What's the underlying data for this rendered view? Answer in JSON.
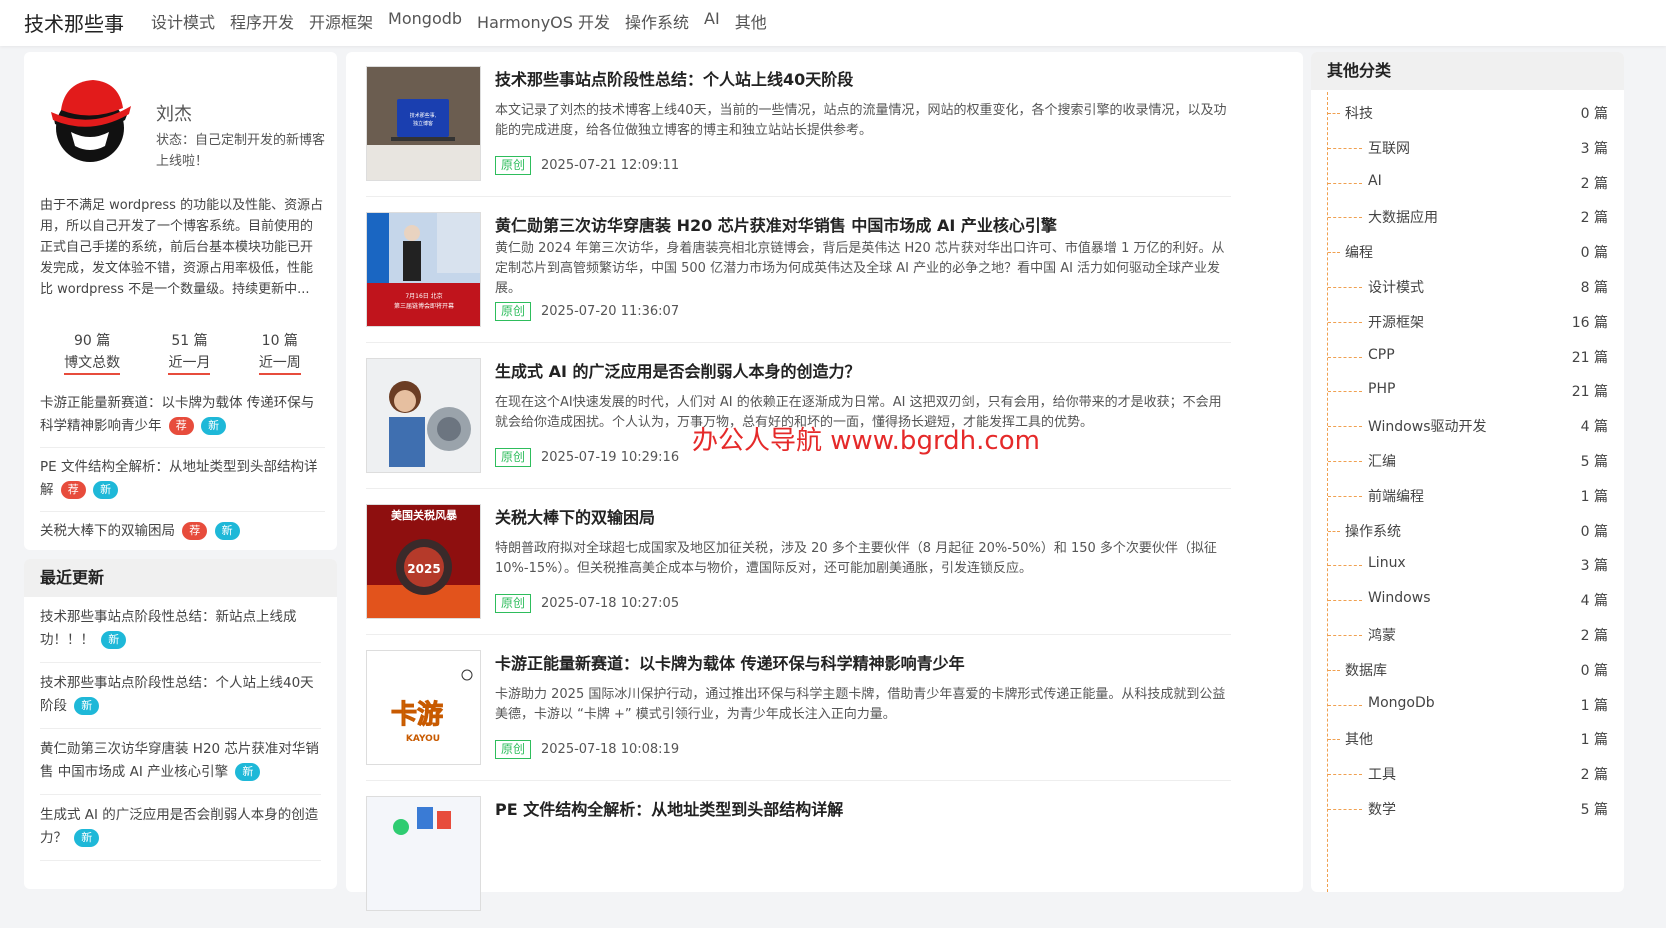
{
  "header": {
    "logo": "技术那些事",
    "nav": [
      "设计模式",
      "程序开发",
      "开源框架",
      "Mongodb",
      "HarmonyOS 开发",
      "操作系统",
      "AI",
      "其他"
    ]
  },
  "profile": {
    "name": "刘杰",
    "status": "状态：自己定制开发的新博客上线啦！",
    "bio": "由于不满足 wordpress 的功能以及性能、资源占用，所以自己开发了一个博客系统。目前使用的正式自己手搓的系统，前后台基本模块功能已开发完成，发文体验不错，资源占用率极低，性能比 wordpress 不是一个数量级。持续更新中...",
    "stats": [
      {
        "num": "90 篇",
        "label": "博文总数"
      },
      {
        "num": "51 篇",
        "label": "近一月"
      },
      {
        "num": "10 篇",
        "label": "近一周"
      }
    ],
    "hot": [
      {
        "text": "卡游正能量新赛道：以卡牌为载体 传递环保与科学精神影响青少年",
        "hot": "荐",
        "new": "新"
      },
      {
        "text": "PE 文件结构全解析：从地址类型到头部结构详解",
        "hot": "荐",
        "new": "新"
      },
      {
        "text": "关税大棒下的双输困局",
        "hot": "荐",
        "new": "新"
      }
    ]
  },
  "recent": {
    "title": "最近更新",
    "items": [
      {
        "text": "技术那些事站点阶段性总结：新站点上线成功！！！",
        "new": "新"
      },
      {
        "text": "技术那些事站点阶段性总结：个人站上线40天阶段",
        "new": "新"
      },
      {
        "text": "黄仁勋第三次访华穿唐装 H20 芯片获准对华销售 中国市场成 AI 产业核心引擎",
        "new": "新"
      },
      {
        "text": "生成式 AI 的广泛应用是否会削弱人本身的创造力？",
        "new": "新"
      }
    ]
  },
  "articles": [
    {
      "title": "技术那些事站点阶段性总结：个人站上线40天阶段",
      "desc": "本文记录了刘杰的技术博客上线40天，当前的一些情况，站点的流量情况，网站的权重变化，各个搜索引擎的收录情况，以及功能的完成进度，给各位做独立博客的博主和独立站站长提供参考。",
      "tag": "原创",
      "date": "2025-07-21 12:09:11",
      "thumb_text": "技术那些事,\n独立博客"
    },
    {
      "title": "黄仁勋第三次访华穿唐装 H20 芯片获准对华销售 中国市场成 AI 产业核心引擎",
      "desc": "黄仁勋 2024 年第三次访华，身着唐装亮相北京链博会，背后是英伟达 H20 芯片获对华出口许可、市值暴增 1 万亿的利好。从定制芯片到高管频繁访华，中国 500 亿潜力市场为何成英伟达及全球 AI 产业的必争之地？看中国 AI 活力如何驱动全球产业发展。",
      "tag": "原创",
      "date": "2025-07-20 11:36:07",
      "thumb_text": "7月16日 北京\n第三届链博会即将开幕"
    },
    {
      "title": "生成式 AI 的广泛应用是否会削弱人本身的创造力？",
      "desc": "在现在这个AI快速发展的时代，人们对 AI 的依赖正在逐渐成为日常。AI 这把双刃剑，只有会用，给你带来的才是收获；不会用就会给你造成困扰。个人认为，万事万物，总有好的和坏的一面，懂得扬长避短，才能发挥工具的优势。",
      "tag": "原创",
      "date": "2025-07-19 10:29:16",
      "thumb_text": ""
    },
    {
      "title": "关税大棒下的双输困局",
      "desc": "特朗普政府拟对全球超七成国家及地区加征关税，涉及 20 多个主要伙伴（8 月起征 20%-50%）和 150 多个次要伙伴（拟征 10%-15%）。但关税推高美企成本与物价，遭国际反对，还可能加剧美通胀，引发连锁反应。",
      "tag": "原创",
      "date": "2025-07-18 10:27:05",
      "thumb_text": "美国关税风暴\n2025"
    },
    {
      "title": "卡游正能量新赛道：以卡牌为载体 传递环保与科学精神影响青少年",
      "desc": "卡游助力 2025 国际冰川保护行动，通过推出环保与科学主题卡牌，借助青少年喜爱的卡牌形式传递正能量。从科技成就到公益美德，卡游以 “卡牌 +” 模式引领行业，为青少年成长注入正向力量。",
      "tag": "原创",
      "date": "2025-07-18 10:08:19",
      "thumb_text": "卡游\nKAYOU"
    },
    {
      "title": "PE 文件结构全解析：从地址类型到头部结构详解",
      "desc": "",
      "tag": "",
      "date": "",
      "thumb_text": ""
    }
  ],
  "categories": {
    "title": "其他分类",
    "items": [
      {
        "name": "科技",
        "count": "0 篇",
        "level": 1
      },
      {
        "name": "互联网",
        "count": "3 篇",
        "level": 2
      },
      {
        "name": "AI",
        "count": "2 篇",
        "level": 2
      },
      {
        "name": "大数据应用",
        "count": "2 篇",
        "level": 2
      },
      {
        "name": "编程",
        "count": "0 篇",
        "level": 1
      },
      {
        "name": "设计模式",
        "count": "8 篇",
        "level": 2
      },
      {
        "name": "开源框架",
        "count": "16 篇",
        "level": 2
      },
      {
        "name": "CPP",
        "count": "21 篇",
        "level": 2
      },
      {
        "name": "PHP",
        "count": "21 篇",
        "level": 2
      },
      {
        "name": "Windows驱动开发",
        "count": "4 篇",
        "level": 2
      },
      {
        "name": "汇编",
        "count": "5 篇",
        "level": 2
      },
      {
        "name": "前端编程",
        "count": "1 篇",
        "level": 2
      },
      {
        "name": "操作系统",
        "count": "0 篇",
        "level": 1
      },
      {
        "name": "Linux",
        "count": "3 篇",
        "level": 2
      },
      {
        "name": "Windows",
        "count": "4 篇",
        "level": 2
      },
      {
        "name": "鸿蒙",
        "count": "2 篇",
        "level": 2
      },
      {
        "name": "数据库",
        "count": "0 篇",
        "level": 1
      },
      {
        "name": "MongoDb",
        "count": "1 篇",
        "level": 2
      },
      {
        "name": "其他",
        "count": "1 篇",
        "level": 1
      },
      {
        "name": "工具",
        "count": "2 篇",
        "level": 2
      },
      {
        "name": "数学",
        "count": "5 篇",
        "level": 2
      }
    ]
  },
  "watermark": "办公人导航 www.bgrdh.com",
  "colors": {
    "hot_badge": "#e74c3c",
    "new_badge": "#1eb8d8",
    "original_tag": "#2ebd5c",
    "tree_line": "#f0a050"
  }
}
